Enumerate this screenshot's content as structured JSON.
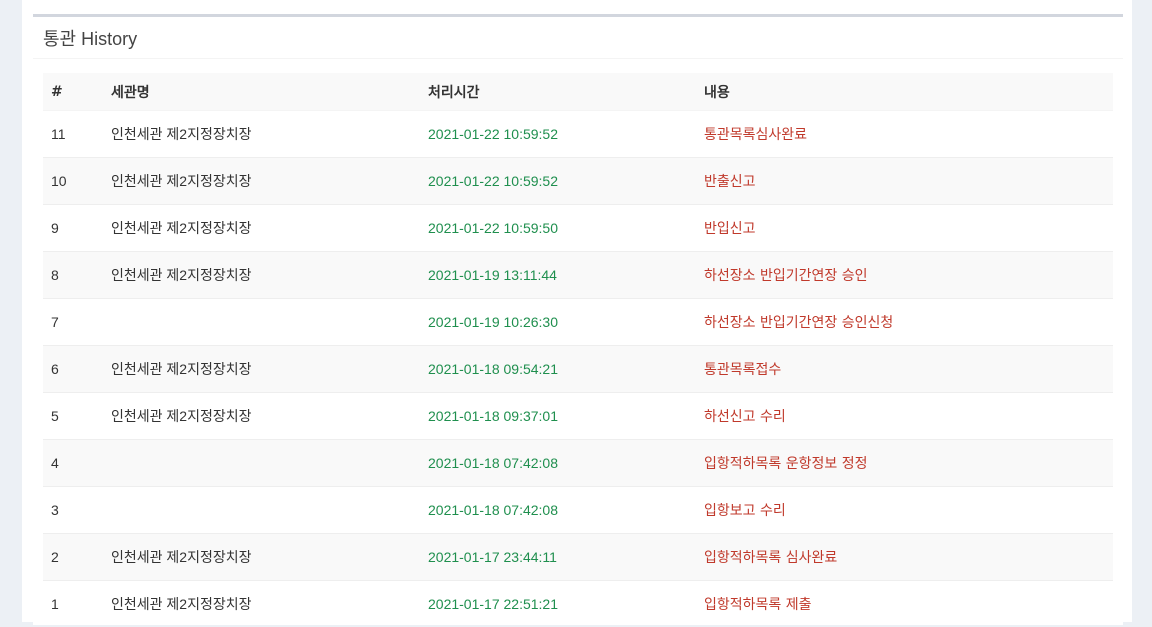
{
  "panel": {
    "title": "통관 History"
  },
  "table": {
    "headers": {
      "num": "#",
      "office": "세관명",
      "time": "처리시간",
      "content": "내용"
    },
    "rows": [
      {
        "num": "11",
        "office": "인천세관 제2지정장치장",
        "time": "2021-01-22 10:59:52",
        "content": "통관목록심사완료"
      },
      {
        "num": "10",
        "office": "인천세관 제2지정장치장",
        "time": "2021-01-22 10:59:52",
        "content": "반출신고"
      },
      {
        "num": "9",
        "office": "인천세관 제2지정장치장",
        "time": "2021-01-22 10:59:50",
        "content": "반입신고"
      },
      {
        "num": "8",
        "office": "인천세관 제2지정장치장",
        "time": "2021-01-19 13:11:44",
        "content": "하선장소 반입기간연장 승인"
      },
      {
        "num": "7",
        "office": "",
        "time": "2021-01-19 10:26:30",
        "content": "하선장소 반입기간연장 승인신청"
      },
      {
        "num": "6",
        "office": "인천세관 제2지정장치장",
        "time": "2021-01-18 09:54:21",
        "content": "통관목록접수"
      },
      {
        "num": "5",
        "office": "인천세관 제2지정장치장",
        "time": "2021-01-18 09:37:01",
        "content": "하선신고 수리"
      },
      {
        "num": "4",
        "office": "",
        "time": "2021-01-18 07:42:08",
        "content": "입항적하목록 운항정보 정정"
      },
      {
        "num": "3",
        "office": "",
        "time": "2021-01-18 07:42:08",
        "content": "입항보고 수리"
      },
      {
        "num": "2",
        "office": "인천세관 제2지정장치장",
        "time": "2021-01-17 23:44:11",
        "content": "입항적하목록 심사완료"
      },
      {
        "num": "1",
        "office": "인천세관 제2지정장치장",
        "time": "2021-01-17 22:51:21",
        "content": "입항적하목록 제출"
      }
    ]
  },
  "colors": {
    "time": "#1f8f4e",
    "content": "#c0392b",
    "border_top": "#d2d6de"
  }
}
